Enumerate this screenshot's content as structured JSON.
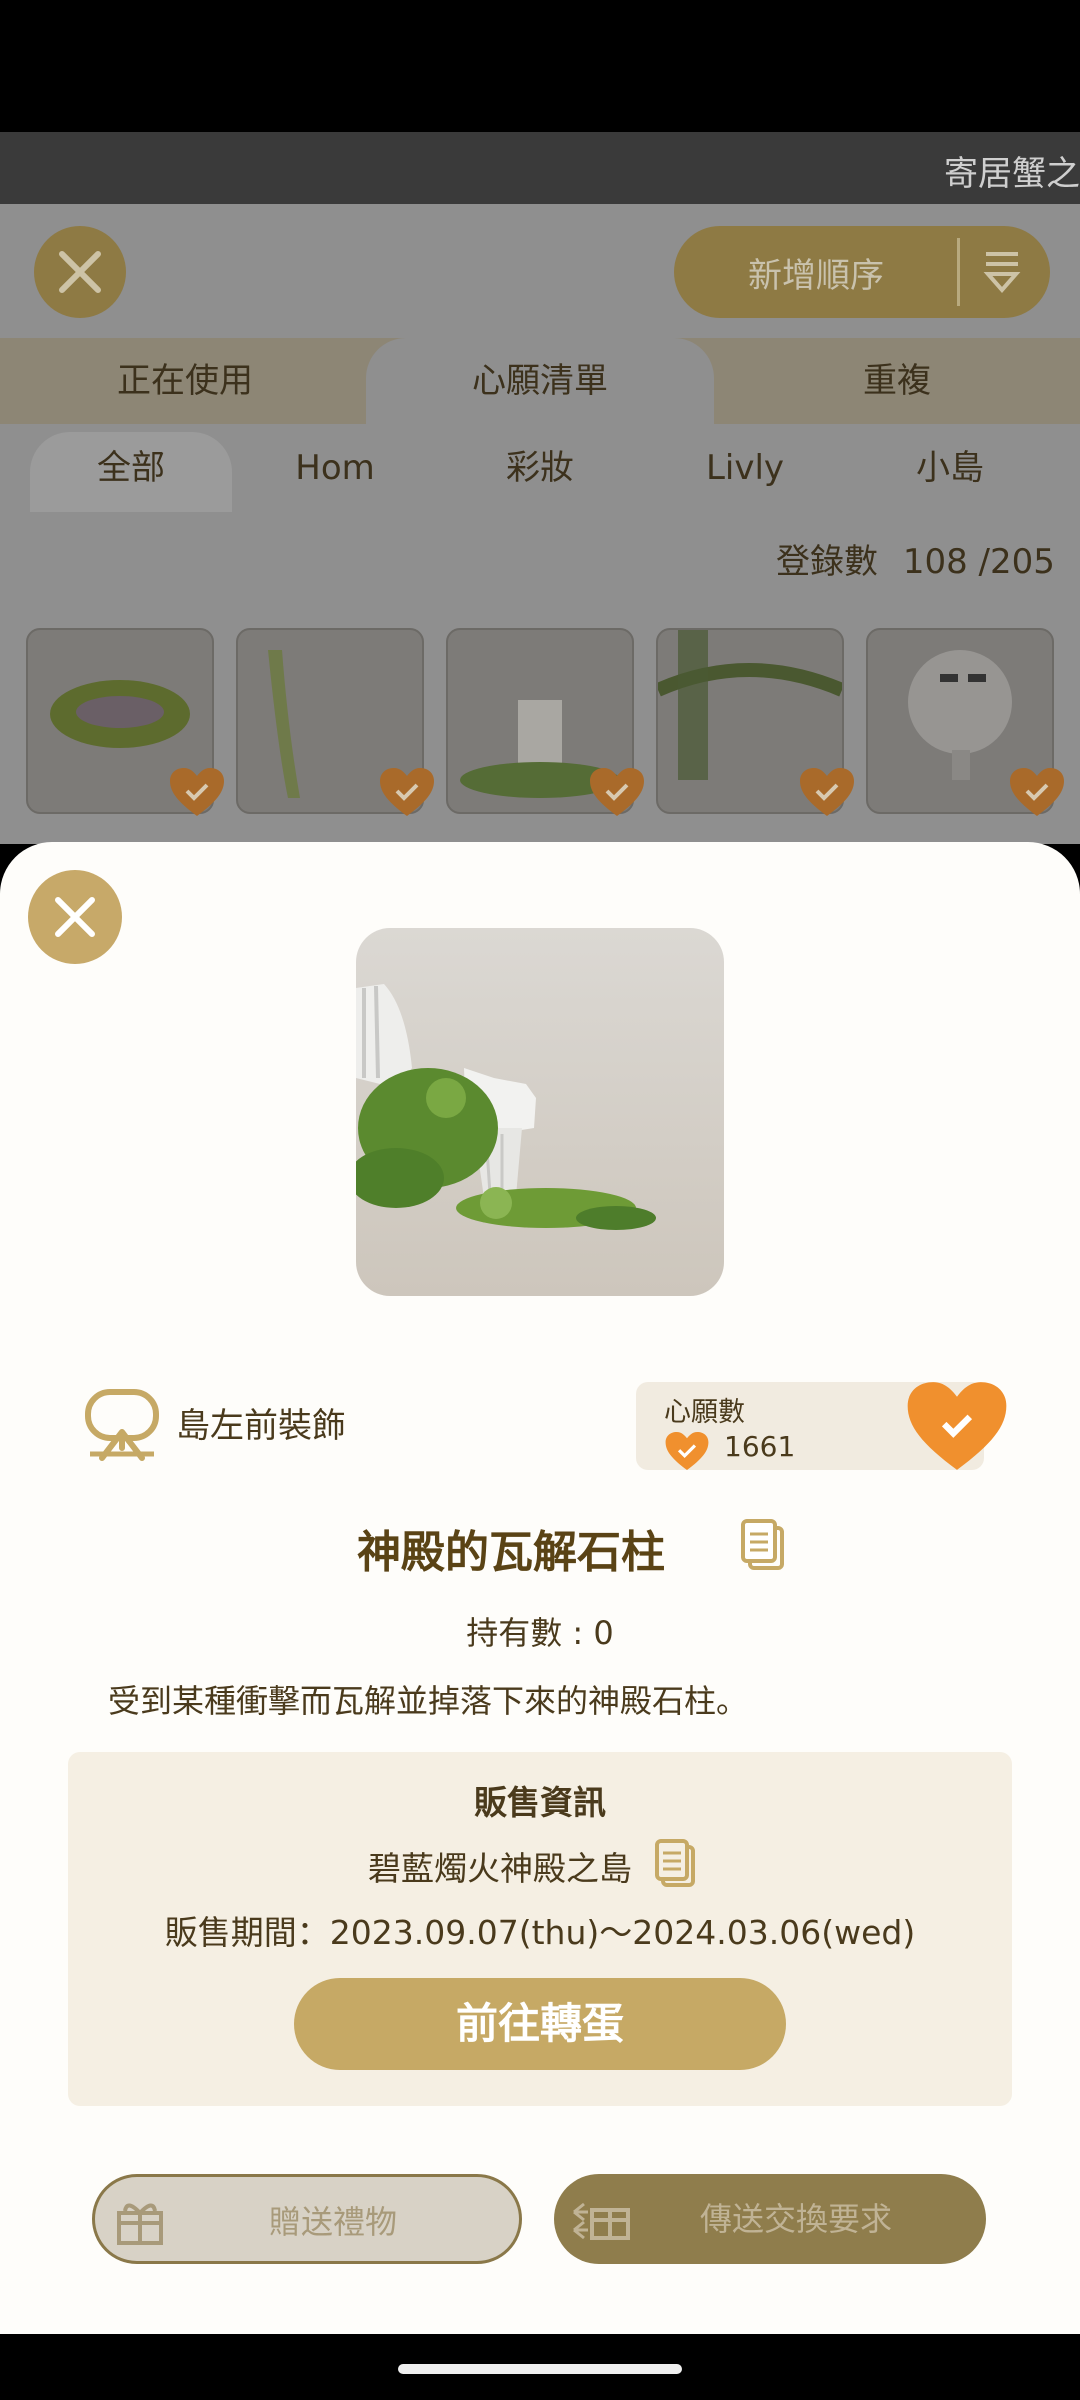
{
  "titlebar": {
    "text": "寄居蟹之"
  },
  "background": {
    "sort_label": "新增順序",
    "tabs": [
      "正在使用",
      "心願清單",
      "重複"
    ],
    "subtabs": [
      "全部",
      "Hom",
      "彩妝",
      "Livly",
      "小島"
    ],
    "registered_label": "登錄數",
    "registered_value": "108 /205"
  },
  "item": {
    "category": "島左前裝飾",
    "wish_label": "心願數",
    "wish_count": "1661",
    "title": "神殿的瓦解石柱",
    "owned": "持有數 : 0",
    "description": "受到某種衝擊而瓦解並掉落下來的神殿石柱。"
  },
  "sale": {
    "title": "販售資訊",
    "place": "碧藍燭火神殿之島",
    "period": "販售期間：2023.09.07(thu)～2024.03.06(wed)",
    "go_button": "前往轉蛋"
  },
  "actions": {
    "gift": "贈送禮物",
    "trade": "傳送交換要求"
  },
  "colors": {
    "accent_gold": "#c6a965",
    "wish_orange": "#f0902e",
    "text_brown": "#4a3a1c"
  }
}
